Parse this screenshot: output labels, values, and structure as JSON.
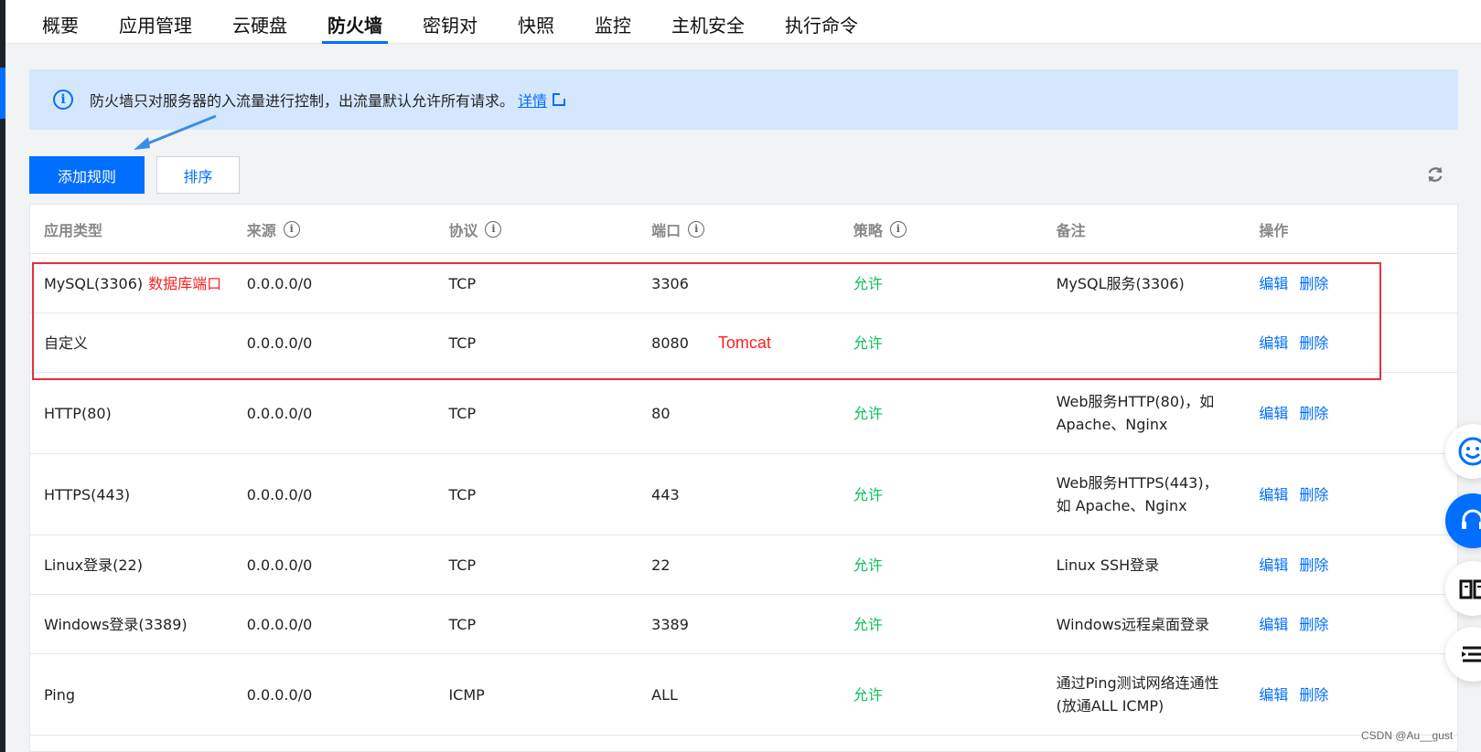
{
  "tabs": [
    {
      "label": "概要",
      "active": false
    },
    {
      "label": "应用管理",
      "active": false
    },
    {
      "label": "云硬盘",
      "active": false
    },
    {
      "label": "防火墙",
      "active": true
    },
    {
      "label": "密钥对",
      "active": false
    },
    {
      "label": "快照",
      "active": false
    },
    {
      "label": "监控",
      "active": false
    },
    {
      "label": "主机安全",
      "active": false
    },
    {
      "label": "执行命令",
      "active": false
    }
  ],
  "notice": {
    "text": "防火墙只对服务器的入流量进行控制，出流量默认允许所有请求。",
    "link_label": "详情",
    "icon": "info-icon"
  },
  "toolbar": {
    "add_rule_label": "添加规则",
    "sort_label": "排序",
    "refresh_icon": "refresh-icon"
  },
  "table": {
    "headers": {
      "app_type": "应用类型",
      "source": "来源",
      "protocol": "协议",
      "port": "端口",
      "policy": "策略",
      "remark": "备注",
      "action": "操作"
    },
    "rows": [
      {
        "app_type": "MySQL(3306)",
        "annotation": "数据库端口",
        "source": "0.0.0.0/0",
        "protocol": "TCP",
        "port": "3306",
        "port_annotation": "",
        "policy": "允许",
        "remark": "MySQL服务(3306)",
        "edit": "编辑",
        "delete": "删除"
      },
      {
        "app_type": "自定义",
        "annotation": "",
        "source": "0.0.0.0/0",
        "protocol": "TCP",
        "port": "8080",
        "port_annotation": "Tomcat",
        "policy": "允许",
        "remark": "",
        "edit": "编辑",
        "delete": "删除"
      },
      {
        "app_type": "HTTP(80)",
        "annotation": "",
        "source": "0.0.0.0/0",
        "protocol": "TCP",
        "port": "80",
        "port_annotation": "",
        "policy": "允许",
        "remark": "Web服务HTTP(80)，如 Apache、Nginx",
        "edit": "编辑",
        "delete": "删除"
      },
      {
        "app_type": "HTTPS(443)",
        "annotation": "",
        "source": "0.0.0.0/0",
        "protocol": "TCP",
        "port": "443",
        "port_annotation": "",
        "policy": "允许",
        "remark": "Web服务HTTPS(443)，如 Apache、Nginx",
        "edit": "编辑",
        "delete": "删除"
      },
      {
        "app_type": "Linux登录(22)",
        "annotation": "",
        "source": "0.0.0.0/0",
        "protocol": "TCP",
        "port": "22",
        "port_annotation": "",
        "policy": "允许",
        "remark": "Linux SSH登录",
        "edit": "编辑",
        "delete": "删除"
      },
      {
        "app_type": "Windows登录(3389)",
        "annotation": "",
        "source": "0.0.0.0/0",
        "protocol": "TCP",
        "port": "3389",
        "port_annotation": "",
        "policy": "允许",
        "remark": "Windows远程桌面登录",
        "edit": "编辑",
        "delete": "删除"
      },
      {
        "app_type": "Ping",
        "annotation": "",
        "source": "0.0.0.0/0",
        "protocol": "ICMP",
        "port": "ALL",
        "port_annotation": "",
        "policy": "允许",
        "remark": "通过Ping测试网络连通性(放通ALL ICMP)",
        "edit": "编辑",
        "delete": "删除"
      }
    ]
  },
  "floating": [
    "smile-icon",
    "headset-icon",
    "book-icon",
    "list-icon"
  ],
  "watermark": "CSDN @Au__gust",
  "colors": {
    "primary": "#006eff",
    "allow": "#0abf5b",
    "annotation": "#ff1f1f",
    "notice_bg": "#d5e7ff"
  }
}
